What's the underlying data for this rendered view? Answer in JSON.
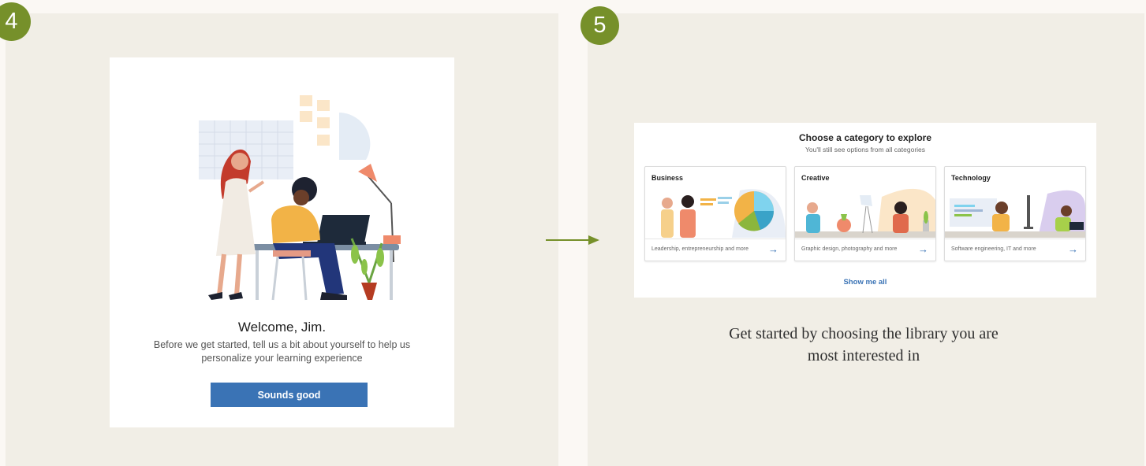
{
  "steps": {
    "left": "4",
    "right": "5"
  },
  "welcome": {
    "title": "Welcome, Jim.",
    "body": "Before we get started, tell us a bit about yourself to help us personalize your learning experience",
    "button": "Sounds good"
  },
  "explore": {
    "title": "Choose a category to explore",
    "subtitle": "You'll still see options from all categories",
    "categories": [
      {
        "name": "Business",
        "description": "Leadership, entrepreneurship and more"
      },
      {
        "name": "Creative",
        "description": "Graphic design, photography and more"
      },
      {
        "name": "Technology",
        "description": "Software engineering, IT and more"
      }
    ],
    "show_all": "Show me all"
  },
  "caption": "Get started by choosing the library you are most interested in",
  "colors": {
    "step_badge": "#76902a",
    "accent_blue": "#3a73b5",
    "panel": "#f1eee6",
    "page": "#fbf8f4"
  }
}
